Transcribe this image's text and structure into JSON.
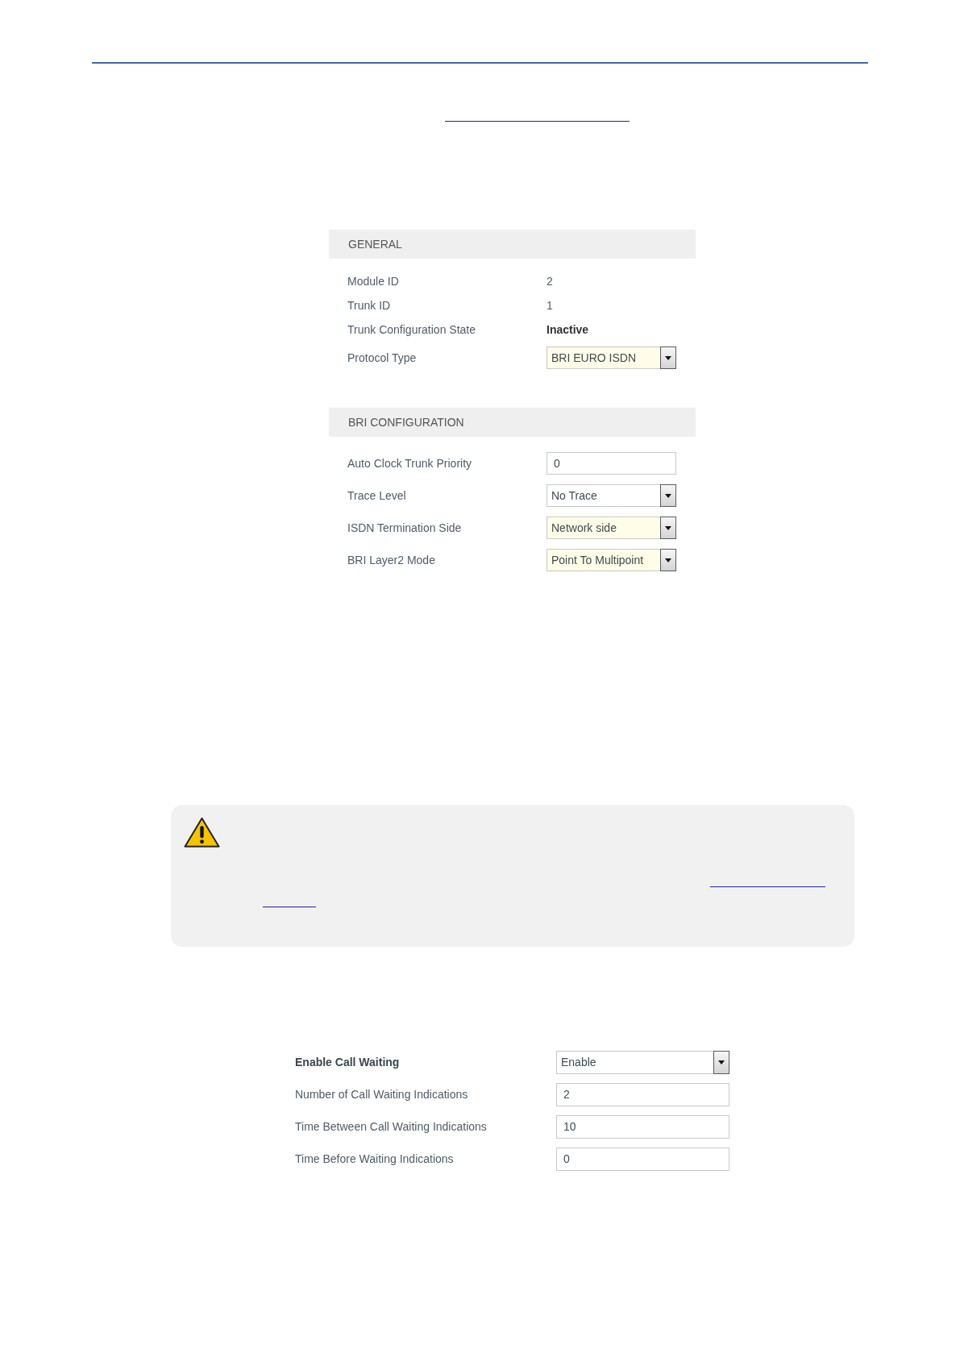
{
  "general_panel": {
    "title": "GENERAL",
    "rows": [
      {
        "kind": "text",
        "label": "Module ID",
        "value": "2",
        "value_bold": false
      },
      {
        "kind": "text",
        "label": "Trunk ID",
        "value": "1",
        "value_bold": false
      },
      {
        "kind": "text",
        "label": "Trunk Configuration State",
        "value": "Inactive",
        "value_bold": true
      },
      {
        "kind": "select",
        "label": "Protocol Type",
        "value": "BRI EURO ISDN",
        "highlighted": true
      }
    ]
  },
  "bri_panel": {
    "title": "BRI CONFIGURATION",
    "rows": [
      {
        "kind": "input",
        "label": "Auto Clock Trunk Priority",
        "value": "0",
        "highlighted": false
      },
      {
        "kind": "select",
        "label": "Trace Level",
        "value": "No Trace",
        "highlighted": false
      },
      {
        "kind": "select",
        "label": "ISDN Termination Side",
        "value": "Network side",
        "highlighted": true
      },
      {
        "kind": "select",
        "label": "BRI Layer2 Mode",
        "value": "Point To Multipoint",
        "highlighted": true
      }
    ]
  },
  "call_waiting_form": {
    "rows": [
      {
        "kind": "select",
        "label": "Enable Call Waiting",
        "label_bold": true,
        "value": "Enable",
        "highlighted": false
      },
      {
        "kind": "input",
        "label": "Number of Call Waiting Indications",
        "label_bold": false,
        "value": "2",
        "highlighted": false
      },
      {
        "kind": "input",
        "label": "Time Between Call Waiting Indications",
        "label_bold": false,
        "value": "10",
        "highlighted": false
      },
      {
        "kind": "input",
        "label": "Time Before Waiting Indications",
        "label_bold": false,
        "value": "0",
        "highlighted": false
      }
    ]
  }
}
